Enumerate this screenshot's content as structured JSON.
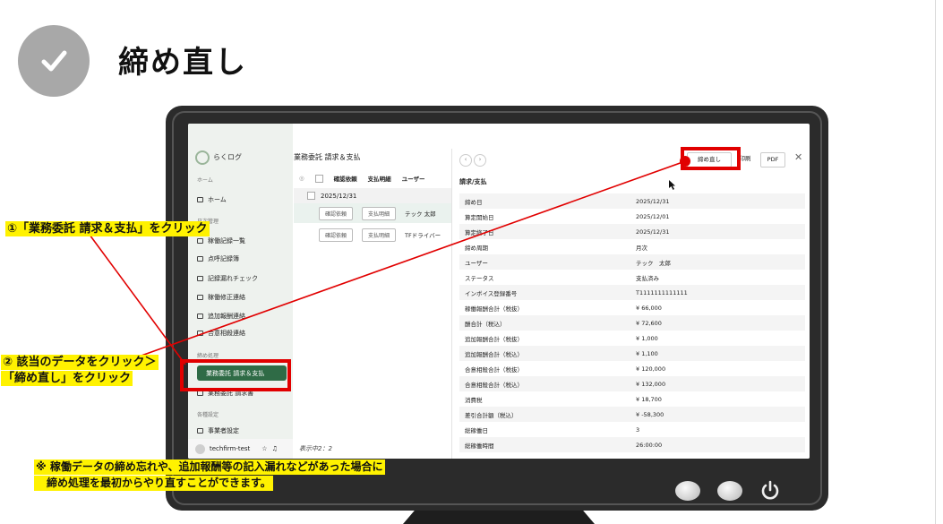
{
  "header": {
    "title": "締め直し",
    "check_icon": "checkmark-icon"
  },
  "app": {
    "logo": "らくログ",
    "sidebar": {
      "sections": [
        {
          "heading": "ホーム"
        },
        {
          "heading": "日次管理"
        },
        {
          "heading": "締め処理"
        },
        {
          "heading": "各種設定"
        }
      ],
      "items": [
        "ホーム",
        "稼働記録一覧",
        "点呼記録簿",
        "記録漏れチェック",
        "稼働修正連絡",
        "追加報酬連絡",
        "合意相殺連絡",
        "業務委託 請求＆支払",
        "業務委託 請求書",
        "事業者設定"
      ],
      "user": "techfirm-test"
    },
    "page_title": "業務委託 請求＆支払",
    "list": {
      "columns": [
        "確認依頼",
        "支払明細",
        "ユーザー"
      ],
      "date_group": "2025/12/31",
      "rows": [
        {
          "confirm": "確認依頼",
          "pay": "支払明細",
          "user": "テック 太郎"
        },
        {
          "confirm": "確認依頼",
          "pay": "支払明細",
          "user": "TFドライバー"
        }
      ],
      "count_text": "表示中2：2"
    },
    "detail": {
      "buttons": {
        "redo": "締め直し",
        "print": "印刷",
        "pdf": "PDF"
      },
      "section_label": "請求/支払",
      "rows": [
        {
          "k": "締め日",
          "v": "2025/12/31"
        },
        {
          "k": "算定開始日",
          "v": "2025/12/01"
        },
        {
          "k": "算定終了日",
          "v": "2025/12/31"
        },
        {
          "k": "締め周期",
          "v": "月次"
        },
        {
          "k": "ユーザー",
          "v": "テック　太郎"
        },
        {
          "k": "ステータス",
          "v": "支払済み"
        },
        {
          "k": "インボイス登録番号",
          "v": "T1111111111111"
        },
        {
          "k": "稼働報酬合計（税抜）",
          "v": "¥ 66,000"
        },
        {
          "k": "酬合計（税込）",
          "v": "¥ 72,600"
        },
        {
          "k": "追加報酬合計（税抜）",
          "v": "¥ 1,000"
        },
        {
          "k": "追加報酬合計（税込）",
          "v": "¥ 1,100"
        },
        {
          "k": "合意相殺合計（税抜）",
          "v": "¥ 120,000"
        },
        {
          "k": "合意相殺合計（税込）",
          "v": "¥ 132,000"
        },
        {
          "k": "消費税",
          "v": "¥ 18,700"
        },
        {
          "k": "差引合計額（税込）",
          "v": "¥ -58,300"
        },
        {
          "k": "総稼働日",
          "v": "3"
        },
        {
          "k": "総稼働時間",
          "v": "26:00:00"
        }
      ]
    }
  },
  "callouts": {
    "step1": "①「業務委託 請求＆支払」をクリック",
    "step2_line1": "② 該当のデータをクリック＞",
    "step2_line2": "「締め直し」をクリック",
    "note_line1": "※ 稼働データの締め忘れや、追加報酬等の記入漏れなどがあった場合に",
    "note_line2": "　締め処理を最初からやり直すことができます。"
  },
  "colors": {
    "highlight": "#e10000",
    "callout_bg": "#fff200",
    "active_nav": "#2f6b46",
    "monitor": "#2b2b2b"
  }
}
